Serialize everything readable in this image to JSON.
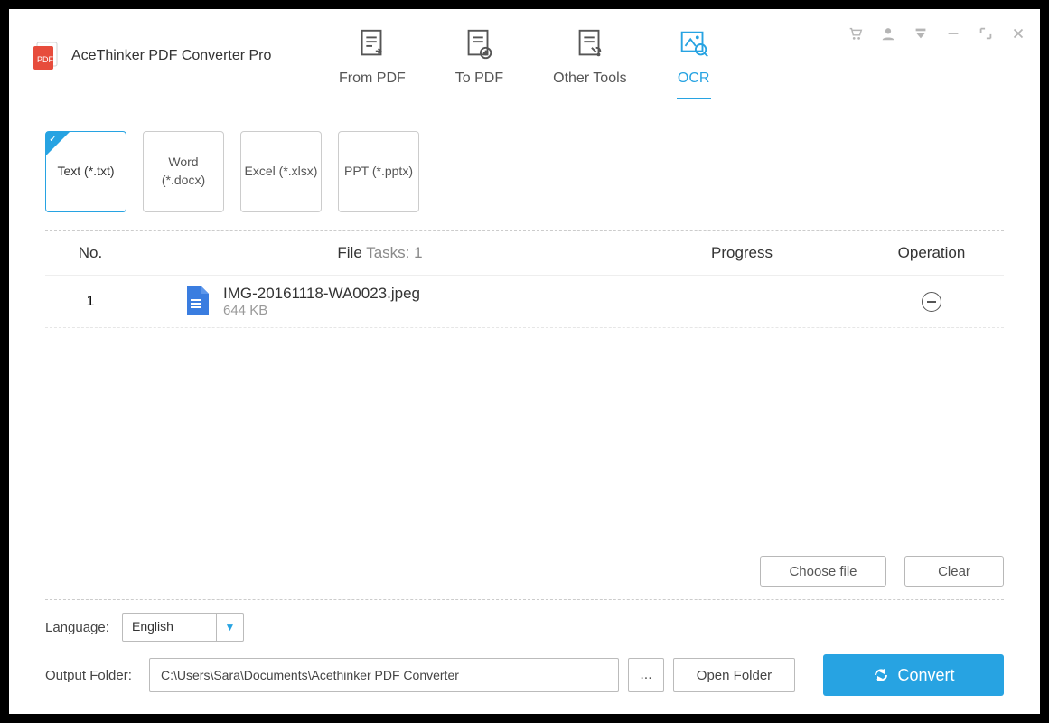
{
  "app_title": "AceThinker PDF Converter Pro",
  "tabs": {
    "from_pdf": "From PDF",
    "to_pdf": "To PDF",
    "other_tools": "Other Tools",
    "ocr": "OCR"
  },
  "formats": {
    "text_line1": "Text (*.txt)",
    "word_line1": "Word",
    "word_line2": "(*.docx)",
    "excel_line1": "Excel (*.xlsx)",
    "ppt_line1": "PPT (*.pptx)"
  },
  "table": {
    "no_header": "No.",
    "file_header": "File",
    "tasks_label": " Tasks: ",
    "tasks_count": "1",
    "progress_header": "Progress",
    "operation_header": "Operation",
    "items": [
      {
        "no": "1",
        "name": "IMG-20161118-WA0023.jpeg",
        "size": "644 KB"
      }
    ]
  },
  "toolbar_buttons": {
    "choose_file": "Choose file",
    "clear": "Clear"
  },
  "footer": {
    "language_label": "Language:",
    "language_value": "English",
    "output_folder_label": "Output Folder:",
    "output_folder_value": "C:\\Users\\Sara\\Documents\\Acethinker PDF Converter",
    "browse": "...",
    "open_folder": "Open Folder",
    "convert": "Convert"
  }
}
